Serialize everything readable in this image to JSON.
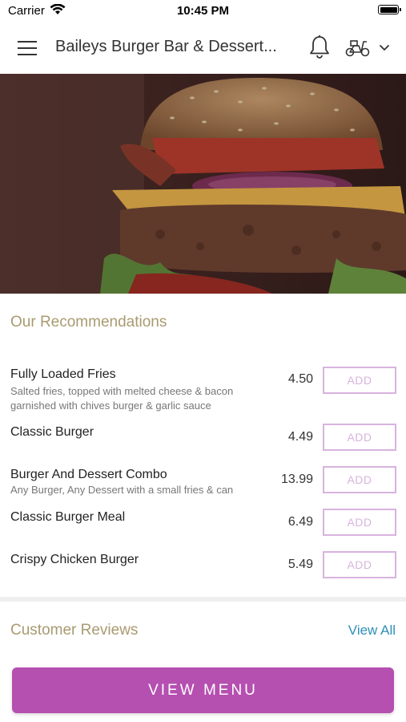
{
  "status_bar": {
    "carrier": "Carrier",
    "time": "10:45 PM"
  },
  "header": {
    "title": "Baileys Burger Bar & Dessert...",
    "icons": [
      "menu-icon",
      "bell-icon",
      "scooter-icon",
      "chevron-down-icon"
    ]
  },
  "hero": {
    "image": "burger-photo"
  },
  "recommendations": {
    "title": "Our Recommendations",
    "add_label": "ADD",
    "items": [
      {
        "name": "Fully Loaded Fries",
        "desc": "Salted fries, topped with melted cheese & bacon garnished with chives burger & garlic sauce",
        "price": "4.50"
      },
      {
        "name": "Classic Burger",
        "desc": "",
        "price": "4.49"
      },
      {
        "name": "Burger And Dessert Combo",
        "desc": "Any Burger, Any Dessert with a small fries & can",
        "price": "13.99"
      },
      {
        "name": "Classic Burger Meal",
        "desc": "",
        "price": "6.49"
      },
      {
        "name": "Crispy Chicken Burger",
        "desc": "",
        "price": "5.49"
      }
    ]
  },
  "reviews": {
    "title": "Customer Reviews",
    "view_all": "View All"
  },
  "footer": {
    "view_menu": "VIEW MENU"
  },
  "colors": {
    "accent": "#b54fb0",
    "add_border": "#d8b3de",
    "section_title": "#a99a70",
    "link": "#2f8fb8"
  }
}
